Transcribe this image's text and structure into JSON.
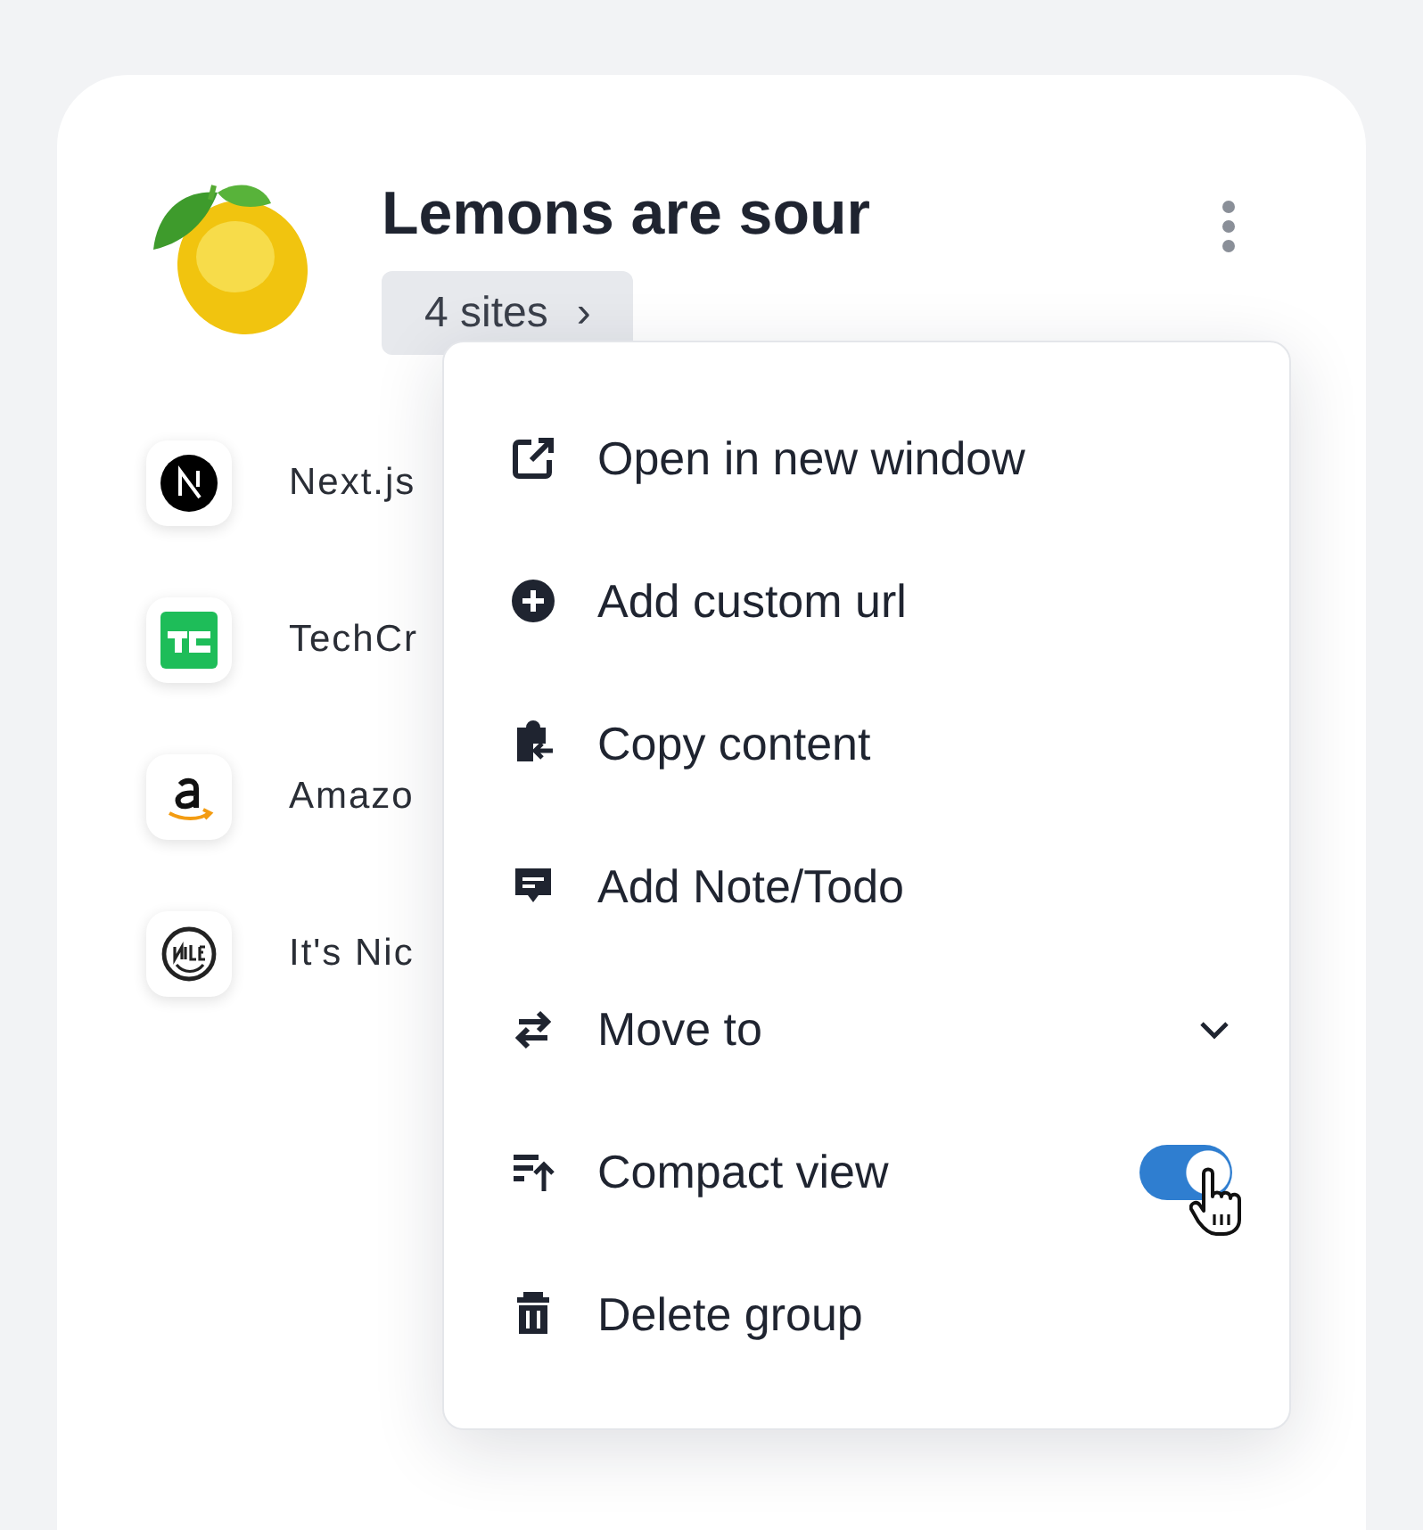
{
  "group": {
    "title": "Lemons are sour",
    "sites_button": "4 sites",
    "sites_chevron": "›"
  },
  "sites": [
    {
      "name": "Next.js"
    },
    {
      "name": "TechCr"
    },
    {
      "name": "Amazo"
    },
    {
      "name": "It's Nic"
    }
  ],
  "menu": [
    {
      "kind": "action",
      "label": "Open in new window"
    },
    {
      "kind": "action",
      "label": "Add custom url"
    },
    {
      "kind": "action",
      "label": "Copy content"
    },
    {
      "kind": "action",
      "label": "Add Note/Todo"
    },
    {
      "kind": "submenu",
      "label": "Move to",
      "expanded": false
    },
    {
      "kind": "toggle",
      "label": "Compact view",
      "on": true
    },
    {
      "kind": "action",
      "label": "Delete group"
    }
  ]
}
